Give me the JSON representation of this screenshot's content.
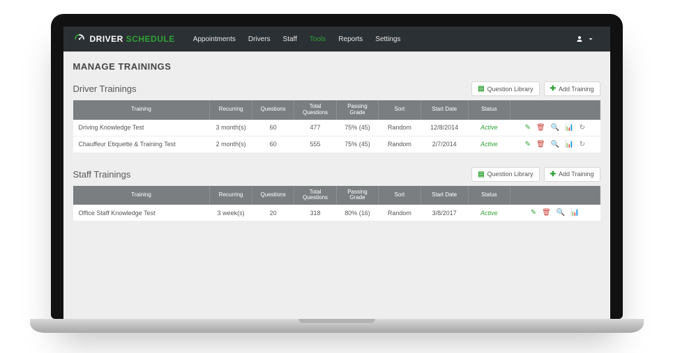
{
  "brand": {
    "word1": "DRIVER",
    "word2": "SCHEDULE"
  },
  "nav": {
    "items": [
      {
        "label": "Appointments",
        "active": false
      },
      {
        "label": "Drivers",
        "active": false
      },
      {
        "label": "Staff",
        "active": false
      },
      {
        "label": "Tools",
        "active": true
      },
      {
        "label": "Reports",
        "active": false
      },
      {
        "label": "Settings",
        "active": false
      }
    ]
  },
  "page_title": "MANAGE TRAININGS",
  "buttons": {
    "question_library": "Question Library",
    "add_training": "Add Training"
  },
  "columns": {
    "training": "Training",
    "recurring": "Recurring",
    "questions": "Questions",
    "total_questions": "Total Questions",
    "passing_grade": "Passing Grade",
    "sort": "Sort",
    "start_date": "Start Date",
    "status": "Status"
  },
  "sections": [
    {
      "title": "Driver Trainings",
      "rows": [
        {
          "training": "Driving Knowledge Test",
          "recurring": "3 month(s)",
          "questions": "60",
          "total_questions": "477",
          "passing_grade": "75% (45)",
          "sort": "Random",
          "start_date": "12/8/2014",
          "status": "Active",
          "has_refresh": true
        },
        {
          "training": "Chauffeur Etiquette & Training Test",
          "recurring": "2 month(s)",
          "questions": "60",
          "total_questions": "555",
          "passing_grade": "75% (45)",
          "sort": "Random",
          "start_date": "2/7/2014",
          "status": "Active",
          "has_refresh": true
        }
      ]
    },
    {
      "title": "Staff Trainings",
      "rows": [
        {
          "training": "Office Staff Knowledge Test",
          "recurring": "3 week(s)",
          "questions": "20",
          "total_questions": "318",
          "passing_grade": "80% (16)",
          "sort": "Random",
          "start_date": "3/8/2017",
          "status": "Active",
          "has_refresh": false
        }
      ]
    }
  ]
}
